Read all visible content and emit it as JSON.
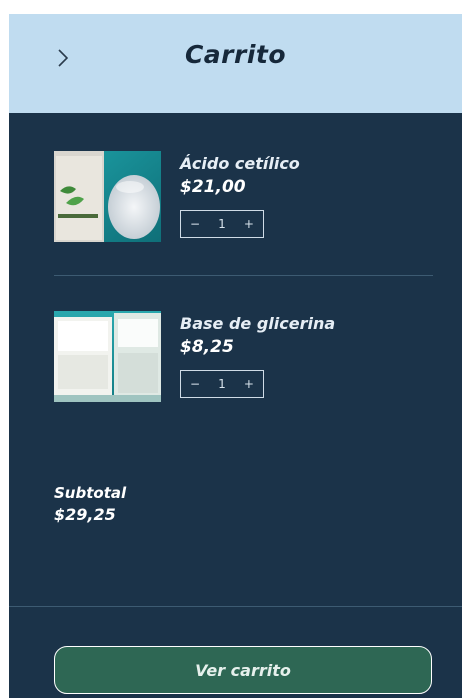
{
  "header": {
    "title": "Carrito",
    "back_icon": "chevron-right-icon"
  },
  "items": [
    {
      "name": "Ácido cetílico",
      "price": "$21,00",
      "qty": {
        "minus": "−",
        "value": "1",
        "plus": "+"
      },
      "image": "bag-and-white-powder-image"
    },
    {
      "name": "Base de glicerina",
      "price": "$8,25",
      "qty": {
        "minus": "−",
        "value": "1",
        "plus": "+"
      },
      "image": "glycerin-soap-block-image"
    }
  ],
  "summary": {
    "subtotal_label": "Subtotal",
    "subtotal_value": "$29,25"
  },
  "footer": {
    "view_cart_label": "Ver carrito"
  },
  "colors": {
    "header_bg": "#c0dcf0",
    "panel_bg": "#1b3349",
    "button_bg": "#2e6754"
  }
}
